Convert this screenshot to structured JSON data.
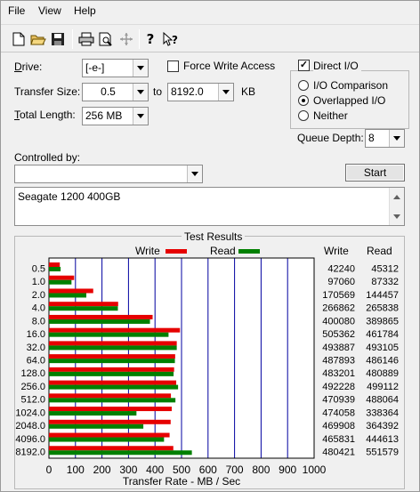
{
  "menu": {
    "file": "File",
    "view": "View",
    "help": "Help"
  },
  "toolbar": {
    "icons": [
      "new-file-icon",
      "open-folder-icon",
      "save-icon",
      "print-icon",
      "print-preview-icon",
      "move-icon",
      "help-icon",
      "context-help-icon"
    ]
  },
  "form": {
    "drive_label": "Drive:",
    "drive_value": "[-e-]",
    "transfer_size_label": "Transfer Size:",
    "transfer_from": "0.5",
    "to_label": "to",
    "transfer_to": "8192.0",
    "kb_label": "KB",
    "total_length_label": "Total Length:",
    "total_length_value": "256 MB",
    "force_write_label": "Force Write Access",
    "force_write_checked": false,
    "direct_io_label": "Direct I/O",
    "direct_io_checked": true,
    "io_comparison_label": "I/O Comparison",
    "overlapped_io_label": "Overlapped I/O",
    "neither_label": "Neither",
    "selected_mode": "overlapped",
    "queue_depth_label": "Queue Depth:",
    "queue_depth_value": "8",
    "controlled_by_label": "Controlled by:",
    "controlled_by_value": "",
    "start_label": "Start",
    "description": "Seagate 1200 400GB"
  },
  "results": {
    "group_title": "Test Results",
    "write_legend": "Write",
    "read_legend": "Read",
    "write_col": "Write",
    "read_col": "Read",
    "write_color": "#e60000",
    "read_color": "#008000",
    "grid_color": "#0000a0"
  },
  "chart_data": {
    "type": "bar",
    "orientation": "horizontal",
    "xlabel": "Transfer Rate - MB / Sec",
    "xlim": [
      0,
      1000
    ],
    "xticks": [
      0,
      100,
      200,
      300,
      400,
      500,
      600,
      700,
      800,
      900,
      1000
    ],
    "categories": [
      "0.5",
      "1.0",
      "2.0",
      "4.0",
      "8.0",
      "16.0",
      "32.0",
      "64.0",
      "128.0",
      "256.0",
      "512.0",
      "1024.0",
      "2048.0",
      "4096.0",
      "8192.0"
    ],
    "series": [
      {
        "name": "Write",
        "values": [
          41,
          95,
          167,
          261,
          391,
          494,
          482,
          476,
          472,
          480,
          460,
          463,
          459,
          455,
          469
        ],
        "labels": [
          "42240",
          "97060",
          "170569",
          "266862",
          "400080",
          "505362",
          "493887",
          "487893",
          "483201",
          "492228",
          "470939",
          "474058",
          "469908",
          "465831",
          "480421"
        ]
      },
      {
        "name": "Read",
        "values": [
          44,
          85,
          141,
          260,
          381,
          451,
          482,
          475,
          470,
          487,
          477,
          330,
          356,
          434,
          539
        ],
        "labels": [
          "45312",
          "87332",
          "144457",
          "265838",
          "389865",
          "461784",
          "493105",
          "486146",
          "480889",
          "499112",
          "488064",
          "338364",
          "364392",
          "444613",
          "551579"
        ]
      }
    ]
  }
}
